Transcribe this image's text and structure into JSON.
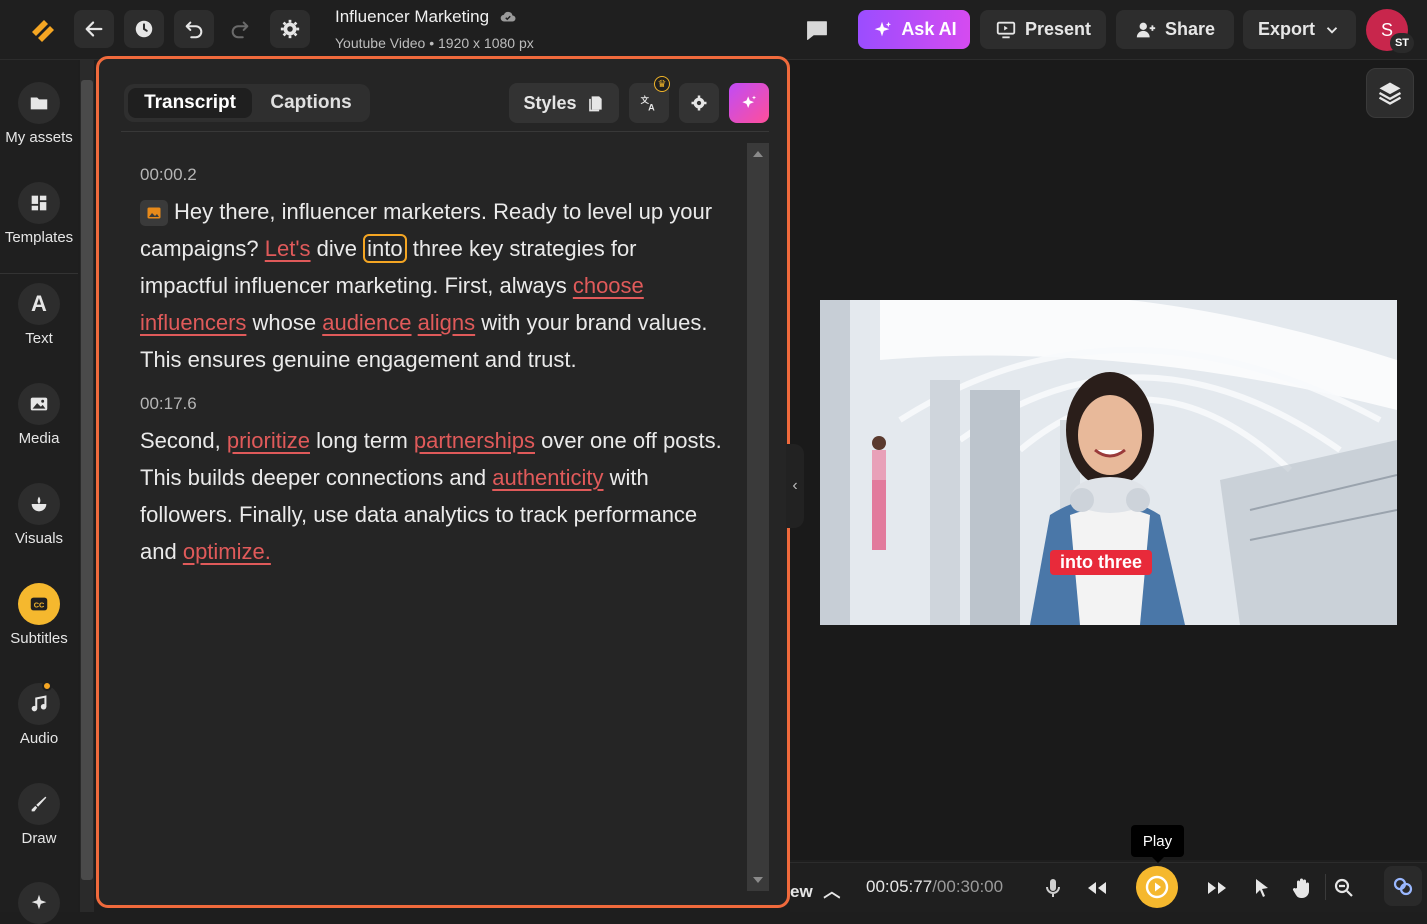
{
  "header": {
    "project_title": "Influencer Marketing",
    "project_subtitle": "Youtube Video • 1920 x 1080 px",
    "ask_ai_label": "Ask AI",
    "present_label": "Present",
    "share_label": "Share",
    "export_label": "Export",
    "avatar_initial": "S",
    "avatar_badge": "ST"
  },
  "sidebar": {
    "items": [
      {
        "label": "My assets"
      },
      {
        "label": "Templates"
      },
      {
        "label": "Text"
      },
      {
        "label": "Media"
      },
      {
        "label": "Visuals"
      },
      {
        "label": "Subtitles"
      },
      {
        "label": "Audio"
      },
      {
        "label": "Draw"
      }
    ]
  },
  "panel": {
    "tabs": [
      {
        "label": "Transcript",
        "active": true
      },
      {
        "label": "Captions",
        "active": false
      }
    ],
    "styles_label": "Styles",
    "segments": [
      {
        "timestamp": "00:00.2",
        "words": [
          {
            "t": "Hey there, influencer marketers. Ready to level up your campaigns? ",
            "s": "n"
          },
          {
            "t": "Let's",
            "s": "h"
          },
          {
            "t": " dive ",
            "s": "n"
          },
          {
            "t": "into",
            "s": "c"
          },
          {
            "t": " three key strategies for impactful influencer marketing. First, always ",
            "s": "n"
          },
          {
            "t": "choose influencers",
            "s": "h"
          },
          {
            "t": " whose ",
            "s": "n"
          },
          {
            "t": "audience",
            "s": "h"
          },
          {
            "t": " ",
            "s": "n"
          },
          {
            "t": "aligns",
            "s": "h"
          },
          {
            "t": " with your brand values. This ensures genuine engagement and trust.",
            "s": "n"
          }
        ]
      },
      {
        "timestamp": "00:17.6",
        "words": [
          {
            "t": "Second, ",
            "s": "n"
          },
          {
            "t": "prioritize",
            "s": "h"
          },
          {
            "t": " long term ",
            "s": "n"
          },
          {
            "t": "partnerships",
            "s": "h"
          },
          {
            "t": " over one off posts. This builds deeper connections and ",
            "s": "n"
          },
          {
            "t": "authenticity",
            "s": "h"
          },
          {
            "t": " with followers. Finally, use data analytics to track performance and ",
            "s": "n"
          },
          {
            "t": "optimize.",
            "s": "h"
          }
        ]
      }
    ]
  },
  "video": {
    "subtitle_text": "into three"
  },
  "playback": {
    "preview_label": "ew",
    "current_time": "00:05:77",
    "total_time": "/00:30:00",
    "play_tooltip": "Play"
  },
  "colors": {
    "accent_orange": "#f06a3c",
    "highlight_red": "#e05a5a",
    "play_yellow": "#f5b82e",
    "ask_ai_purple": "#9b4dff"
  }
}
